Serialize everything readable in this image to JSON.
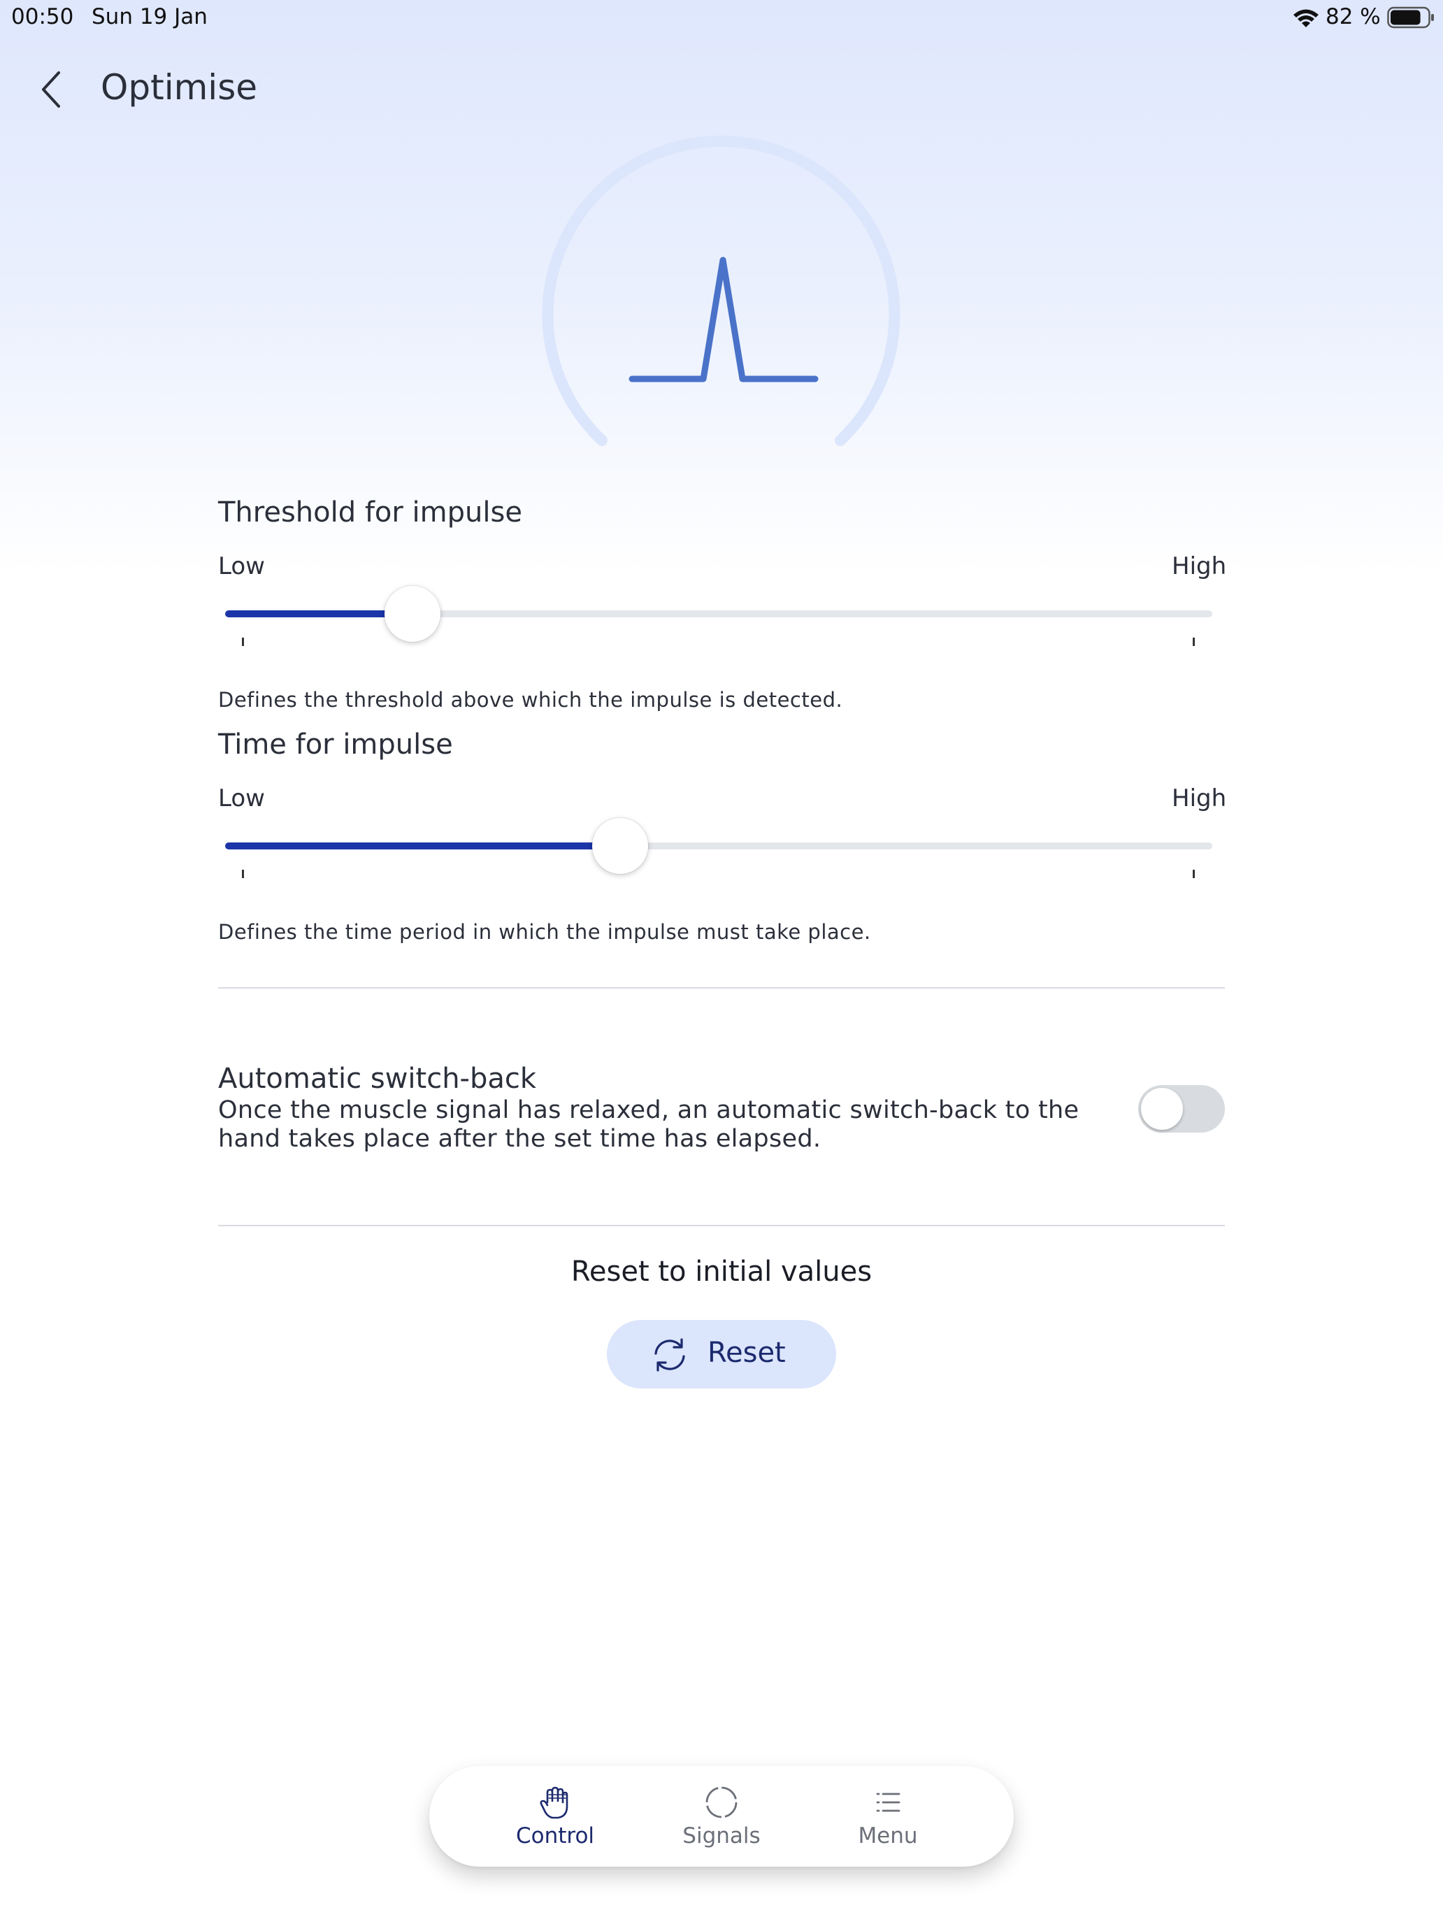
{
  "status_bar": {
    "time": "00:50",
    "date": "Sun 19 Jan",
    "battery_text": "82 %",
    "battery_level": 0.82
  },
  "header": {
    "title": "Optimise"
  },
  "colors": {
    "accent": "#1c35a8",
    "gauge_line": "#4a72c9",
    "gauge_ring": "#dbe5fc",
    "reset_bg": "#dbe5fc"
  },
  "threshold": {
    "title": "Threshold for impulse",
    "low_label": "Low",
    "high_label": "High",
    "value": 0.19,
    "description": "Defines the threshold above which the impulse is detected."
  },
  "time": {
    "title": "Time for impulse",
    "low_label": "Low",
    "high_label": "High",
    "value": 0.4,
    "description": "Defines the time period in which the impulse must take place."
  },
  "auto_switch": {
    "title": "Automatic switch-back",
    "description_line1": "Once the muscle signal has relaxed, an automatic switch-back to the",
    "description_line2": "hand takes place after the set time has elapsed.",
    "enabled": false
  },
  "reset": {
    "heading": "Reset to initial values",
    "button_label": "Reset"
  },
  "nav": {
    "items": [
      {
        "label": "Control",
        "icon": "hand-icon",
        "active": true
      },
      {
        "label": "Signals",
        "icon": "signals-circle-icon",
        "active": false
      },
      {
        "label": "Menu",
        "icon": "menu-list-icon",
        "active": false
      }
    ]
  }
}
